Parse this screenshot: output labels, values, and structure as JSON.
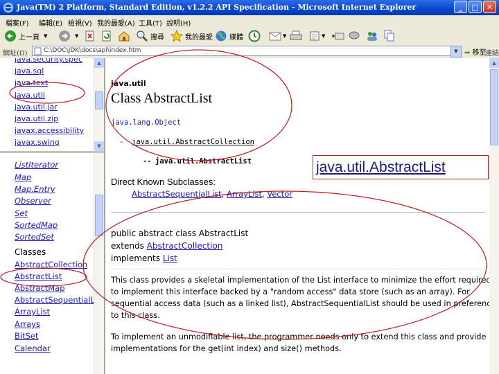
{
  "window": {
    "title": "Java(TM) 2 Platform, Standard Edition, v1.2.2 API Specification - Microsoft Internet Explorer",
    "minimize": "_",
    "maximize": "□",
    "close": "✕"
  },
  "menu": [
    "檔案(F)",
    "編輯(E)",
    "檢視(V)",
    "我的最愛(A)",
    "工具(T)",
    "說明(H)"
  ],
  "toolbar": {
    "back_label": "上一頁",
    "search_label": "搜尋",
    "favorites_label": "我的最愛",
    "media_label": "媒體"
  },
  "address": {
    "label": "網址(D)",
    "value": "C:\\DOC\\JDK\\docs\\api\\index.htm",
    "go_label": "移至",
    "links_label": "連結"
  },
  "packages": [
    "java.security.spec",
    "java.sql",
    "java.text",
    "java.util",
    "java.util.jar",
    "java.util.zip",
    "javax.accessibility",
    "javax.swing"
  ],
  "interfaces": [
    "ListIterator",
    "Map",
    "Map.Entry",
    "Observer",
    "Set",
    "SortedMap",
    "SortedSet"
  ],
  "classes_header": "Classes",
  "classes": [
    "AbstractCollection",
    "AbstractList",
    "AbstractMap",
    "AbstractSequentialList",
    "ArrayList",
    "Arrays",
    "BitSet",
    "Calendar"
  ],
  "content": {
    "package": "java.util",
    "class_title": "Class AbstractList",
    "hierarchy_root": "java.lang.Object",
    "hierarchy_mid": "java.util.AbstractCollection",
    "hierarchy_leaf": "java.util.AbstractList",
    "subclasses_header": "Direct Known Subclasses:",
    "subclasses": [
      "AbstractSequentialList",
      "ArrayList",
      "Vector"
    ],
    "decl_line1": "public abstract class AbstractList",
    "decl_line2_prefix": "extends ",
    "decl_line2_link": "AbstractCollection",
    "decl_line3_prefix": "implements ",
    "decl_line3_link": "List",
    "desc_line1": "This class provides a skeletal implementation of the List interface to minimize the effort required",
    "desc_line2": "to implement this interface backed by a \"random access\" data store (such as an array). For",
    "desc_line3": "sequential access data (such as a linked list), AbstractSequentialList should be used in preference",
    "desc_line4": "to this class.",
    "desc2_line1": "To implement an unmodifiable list, the programmer needs only to extend this class and provide",
    "desc2_line2": "implementations for the get(int index) and size() methods."
  },
  "callout": "java.util.AbstractList",
  "colors": {
    "link": "#1a1ab8",
    "annotation": "#c01c1c",
    "titlebar": "#0a46c8"
  }
}
